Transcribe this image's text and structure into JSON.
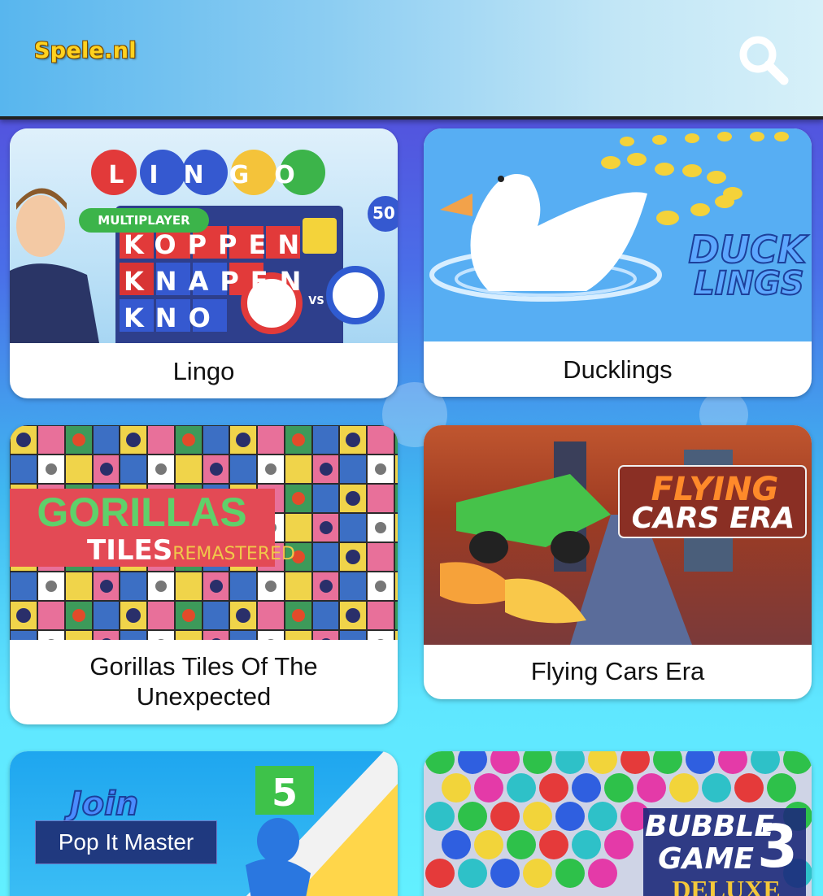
{
  "header": {
    "logo": "Spele.nl",
    "search_icon": "search-icon"
  },
  "games": [
    {
      "title": "Lingo",
      "thumb_text": {
        "logo_letters": [
          "L",
          "I",
          "N",
          "G",
          "O"
        ],
        "badge": "MULTIPLAYER",
        "row1": "KOPPEN",
        "row2": "KNAPEN",
        "row3": "KNO",
        "vs": "VS",
        "corner": "50"
      }
    },
    {
      "title": "Ducklings",
      "thumb_text": {
        "logo_line1": "DUCK",
        "logo_line2": "LINGS"
      }
    },
    {
      "title": "Gorillas Tiles Of The Unexpected",
      "thumb_text": {
        "line1": "GORILLAS",
        "line2": "TILES",
        "line2b": "REMASTERED"
      }
    },
    {
      "title": "Flying Cars Era",
      "thumb_text": {
        "line1": "FLYING",
        "line2": "CARS ERA"
      }
    },
    {
      "title": "Pop It Master",
      "thumb_text": {
        "join": "Join",
        "number": "5"
      }
    },
    {
      "title": "Bubble Game 3 Deluxe",
      "thumb_text": {
        "line1": "BUBBLE",
        "line2": "GAME",
        "number": "3",
        "line3": "DELUXE"
      }
    }
  ],
  "tooltip": {
    "label": "Pop It Master"
  },
  "colors": {
    "logo": "#ffd21f",
    "header_start": "#58b6ee",
    "header_end": "#d6f0f9",
    "card_bg": "#ffffff"
  }
}
